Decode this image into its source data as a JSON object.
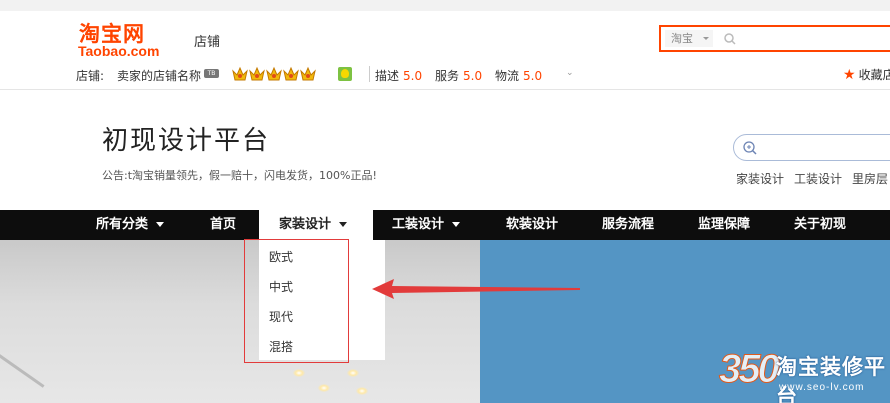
{
  "header": {
    "logo_cn": "淘宝网",
    "logo_en": "Taobao.com",
    "shop_word": "店铺",
    "search_scope": "淘宝"
  },
  "shop_info": {
    "label": "店铺:",
    "shop_name": "卖家的店铺名称",
    "badge": "TB",
    "crown_count": 5,
    "ratings": [
      {
        "label": "描述",
        "value": "5.0"
      },
      {
        "label": "服务",
        "value": "5.0"
      },
      {
        "label": "物流",
        "value": "5.0"
      }
    ],
    "favorite": "收藏店"
  },
  "banner": {
    "title": "初现设计平台",
    "notice": "公告:t淘宝销量领先，假一赔十，闪电发货，100%正品!",
    "tags": [
      "家装设计",
      "工装设计",
      "里房层"
    ]
  },
  "nav": {
    "items": [
      {
        "label": "所有分类",
        "dropdown": true
      },
      {
        "label": "首页",
        "dropdown": false
      },
      {
        "label": "家装设计",
        "dropdown": true
      },
      {
        "label": "工装设计",
        "dropdown": true
      },
      {
        "label": "软装设计",
        "dropdown": false
      },
      {
        "label": "服务流程",
        "dropdown": false
      },
      {
        "label": "监理保障",
        "dropdown": false
      },
      {
        "label": "关于初现",
        "dropdown": false
      }
    ],
    "active_index": 2
  },
  "dropdown": {
    "items": [
      "欧式",
      "中式",
      "现代",
      "混搭"
    ]
  },
  "watermark": {
    "number": "350",
    "text": "淘宝装修平台",
    "url": "www.seo-lv.com"
  },
  "colors": {
    "brand": "#ff4400",
    "nav_bg": "#0d0d0d",
    "annotation": "#e23b3b",
    "hero_blue": "#5495c4"
  }
}
